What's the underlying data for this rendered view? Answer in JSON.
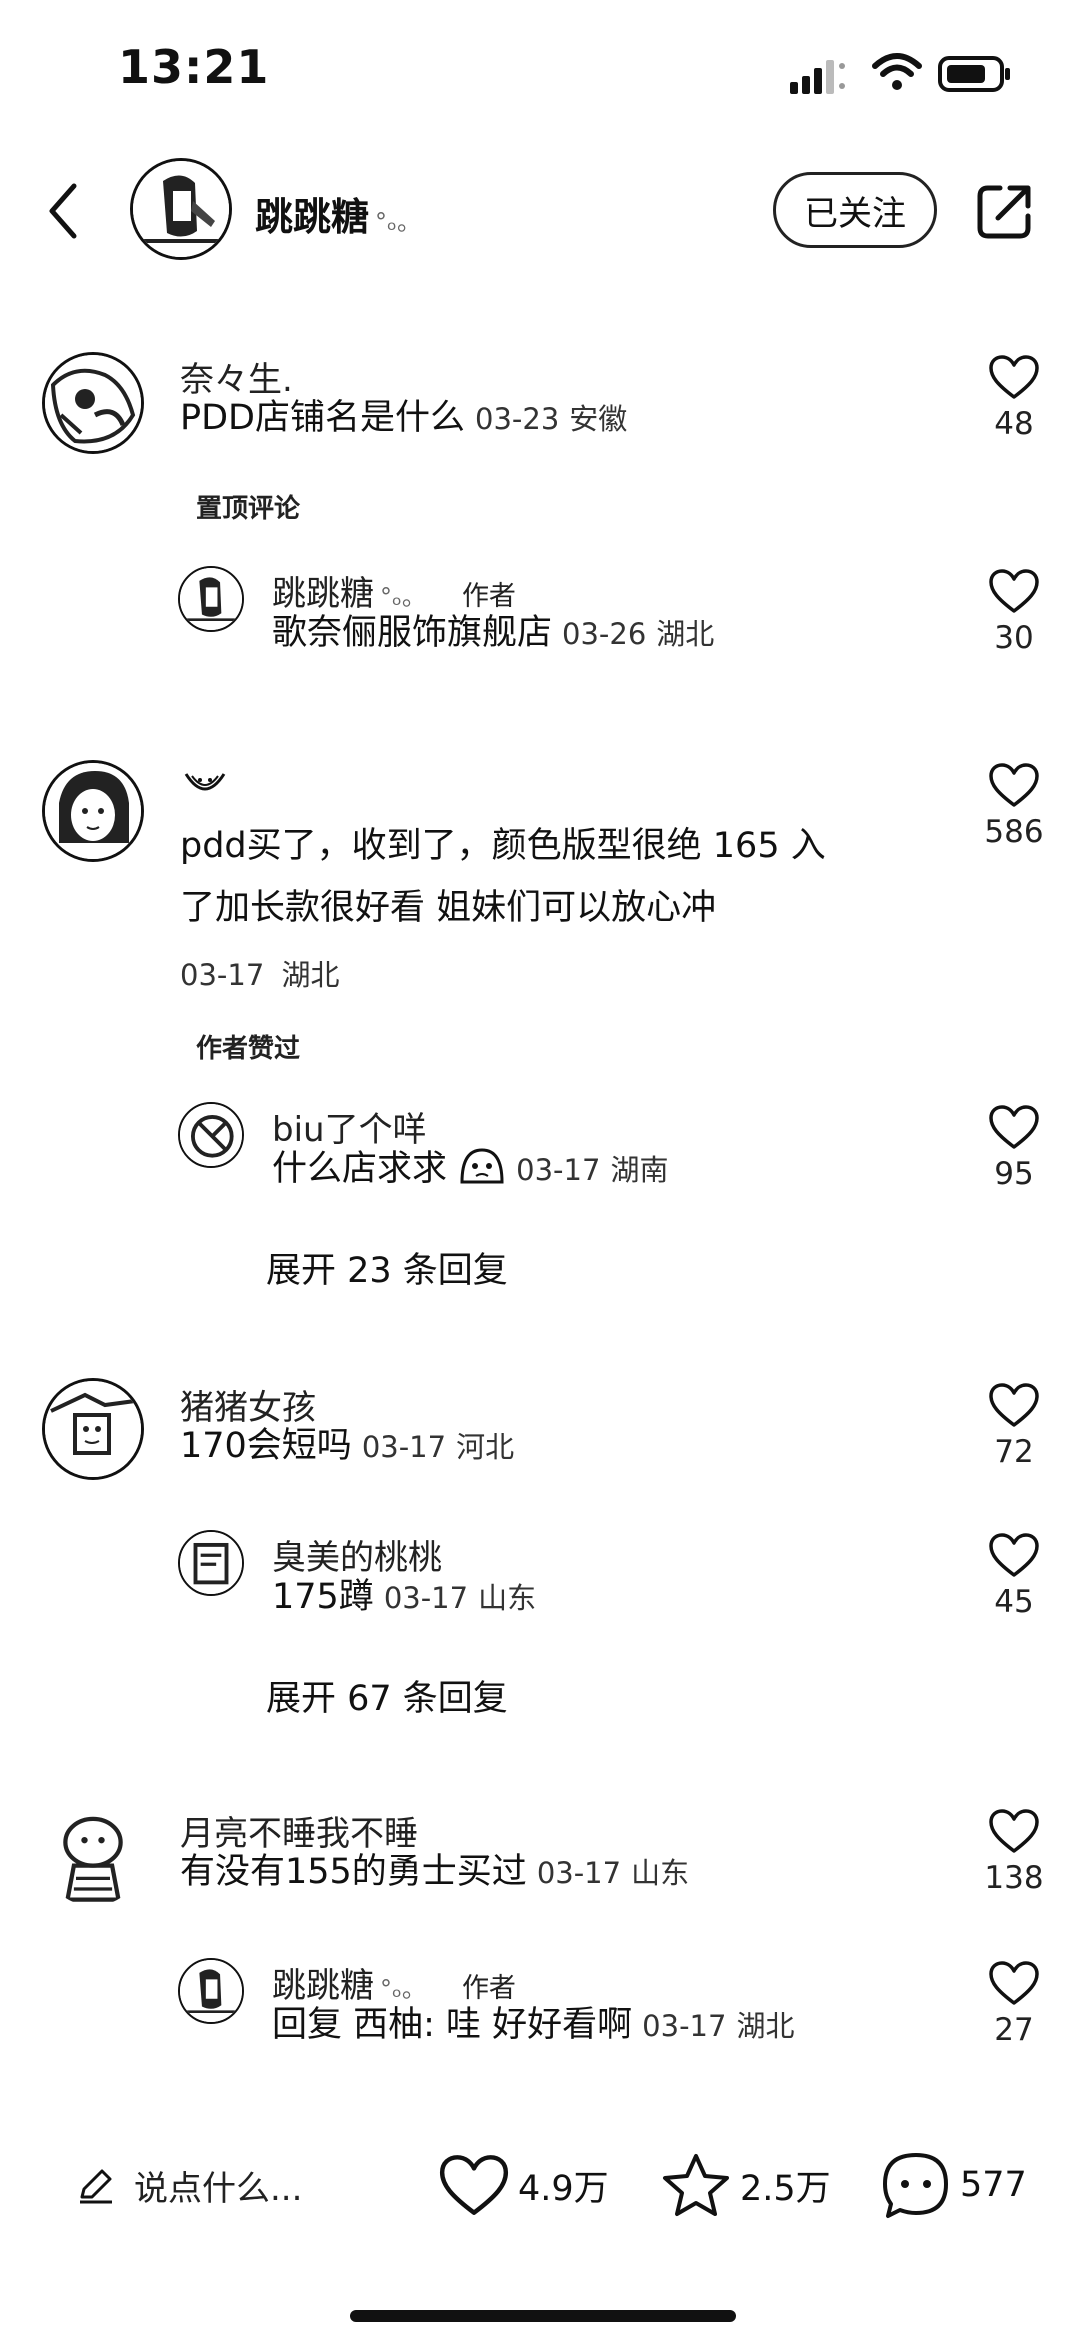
{
  "status": {
    "time": "13:21"
  },
  "header": {
    "username": "跳跳糖",
    "name_deco": "°ₒ。",
    "follow_label": "已关注"
  },
  "comments": [
    {
      "user": "奈々生.",
      "text": "PDD店铺名是什么",
      "date": "03-23",
      "location": "安徽",
      "likes": "48",
      "tag": "置顶评论",
      "reply": {
        "user": "跳跳糖",
        "user_deco": "°ₒ。",
        "author_label": "作者",
        "text": "歌奈俪服饰旗舰店",
        "date": "03-26",
        "location": "湖北",
        "likes": "30"
      }
    },
    {
      "user": "",
      "text_line1": "pdd买了，收到了，颜色版型很绝  165 入",
      "text_line2": "了加长款很好看 姐妹们可以放心冲",
      "date": "03-17",
      "location": "湖北",
      "likes": "586",
      "tag": "作者赞过",
      "reply": {
        "user": "biu了个咩",
        "text": "什么店求求",
        "date": "03-17",
        "location": "湖南",
        "likes": "95"
      },
      "expand_label": "展开 23 条回复"
    },
    {
      "user": "猪猪女孩",
      "text": "170会短吗",
      "date": "03-17",
      "location": "河北",
      "likes": "72",
      "reply": {
        "user": "臭美的桃桃",
        "text": "175蹲",
        "date": "03-17",
        "location": "山东",
        "likes": "45"
      },
      "expand_label": "展开 67 条回复"
    },
    {
      "user": "月亮不睡我不睡",
      "text": "有没有155的勇士买过",
      "date": "03-17",
      "location": "山东",
      "likes": "138",
      "reply": {
        "user": "跳跳糖",
        "user_deco": "°ₒ。",
        "author_label": "作者",
        "text": "回复 西柚: 哇 好好看啊",
        "date": "03-17",
        "location": "湖北",
        "likes": "27"
      }
    }
  ],
  "bottom": {
    "input_placeholder": "说点什么...",
    "likes": "4.9万",
    "favorites": "2.5万",
    "comments": "577"
  },
  "icons": {
    "back": "chevron-left-icon",
    "share": "share-icon",
    "like": "heart-icon",
    "favorite": "star-icon",
    "comment": "comment-bubble-icon",
    "edit": "pencil-icon",
    "signal": "cellular-signal-icon",
    "wifi": "wifi-icon",
    "battery": "battery-icon"
  }
}
